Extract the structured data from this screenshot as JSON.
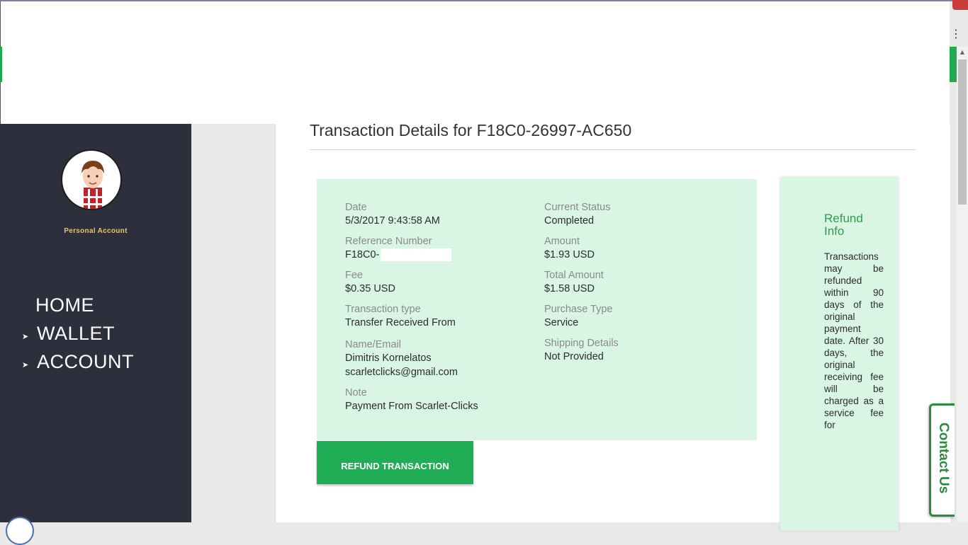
{
  "sidebar": {
    "account_label": "Personal Account",
    "nav": {
      "home": "HOME",
      "wallet": "WALLET",
      "account": "ACCOUNT",
      "arrow": "➤"
    }
  },
  "main": {
    "title": "Transaction Details for F18C0-26997-AC650",
    "fields": {
      "date_label": "Date",
      "date_value": "5/3/2017 9:43:58 AM",
      "status_label": "Current Status",
      "status_value": "Completed",
      "ref_label": "Reference Number",
      "ref_value": "F18C0-",
      "amount_label": "Amount",
      "amount_value": "$1.93 USD",
      "fee_label": "Fee",
      "fee_value": "$0.35 USD",
      "total_label": "Total Amount",
      "total_value": "$1.58 USD",
      "type_label": "Transaction type",
      "type_value": "Transfer Received From",
      "purchase_label": "Purchase Type",
      "purchase_value": "Service",
      "name_label": "Name/Email",
      "name_value": "Dimitris Kornelatos",
      "email_value": "scarletclicks@gmail.com",
      "shipping_label": "Shipping Details",
      "shipping_value": "Not Provided",
      "note_label": "Note",
      "note_value": "Payment From Scarlet-Clicks"
    },
    "refund_button": "REFUND TRANSACTION",
    "refund_info": {
      "title": "Refund Info",
      "body": "Transactions may be refunded within 90 days of the original payment date. After 30 days, the original receiving fee will be charged as a service fee for"
    }
  },
  "contact_tab": "Contact Us",
  "colors": {
    "sidebar_bg": "#2d2f3c",
    "accent_green": "#1fae55",
    "details_bg": "#d9f5e3",
    "account_label": "#e6c27a"
  }
}
